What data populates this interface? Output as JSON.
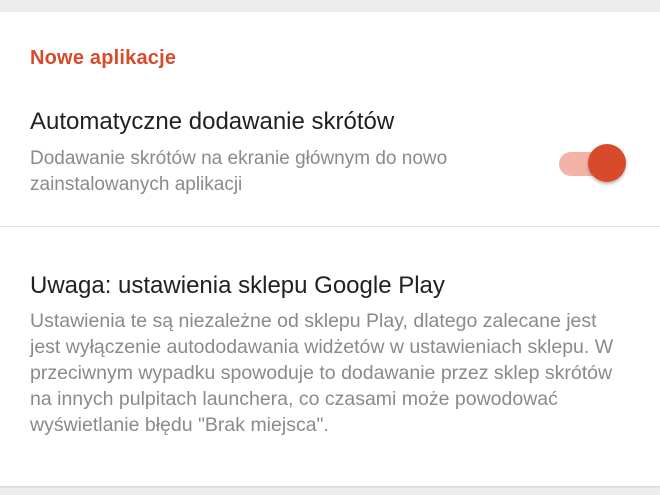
{
  "section": {
    "header": "Nowe aplikacje"
  },
  "auto_shortcuts": {
    "title": "Automatyczne dodawanie skrótów",
    "summary": "Dodawanie skrótów na ekranie głównym do nowo zainstalowanych aplikacji",
    "enabled": true
  },
  "note": {
    "title": "Uwaga: ustawienia sklepu Google Play",
    "body": "Ustawienia te są niezależne od sklepu Play, dlatego zalecane jest jest wyłączenie autododawania widżetów w ustawieniach sklepu. W przeciwnym wypadku spowoduje to dodawanie przez sklep skrótów na innych pulpitach launchera, co czasami może powodować wyświetlanie błędu \"Brak miejsca\"."
  },
  "colors": {
    "accent": "#d94a2b",
    "track_on": "#f3b4a8",
    "title_text": "#212121",
    "summary_text": "#8a8a8a",
    "background": "#ececec",
    "card": "#ffffff"
  }
}
